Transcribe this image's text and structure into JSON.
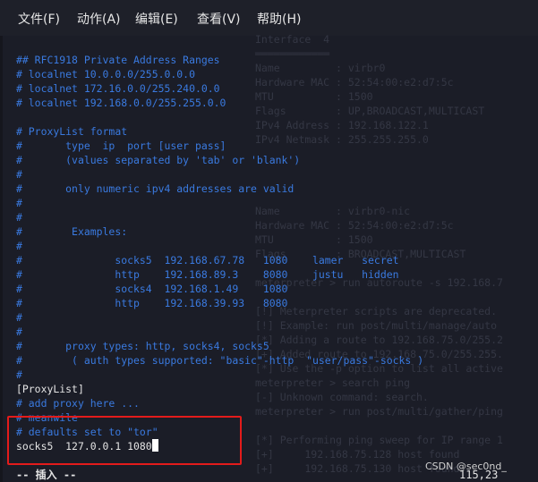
{
  "menu": [
    "文件(F)",
    "动作(A)",
    "编辑(E)",
    "查看(V)",
    "帮助(H)"
  ],
  "background_terminal": [
    "Interface  4",
    "════════════",
    "Name         : virbr0",
    "Hardware MAC : 52:54:00:e2:d7:5c",
    "MTU          : 1500",
    "Flags        : UP,BROADCAST,MULTICAST",
    "IPv4 Address : 192.168.122.1",
    "IPv4 Netmask : 255.255.255.0",
    "",
    "",
    "",
    "",
    "Name         : virbr0-nic",
    "Hardware MAC : 52:54:00:e2:d7:5c",
    "MTU          : 1500",
    "Flags        : BROADCAST,MULTICAST",
    "",
    "meterpreter > run autoroute -s 192.168.7",
    "",
    "[!] Meterpreter scripts are deprecated.",
    "[!] Example: run post/multi/manage/auto",
    "[*] Adding a route to 192.168.75.0/255.2",
    "[+] Added route to 192.168.75.0/255.255.",
    "[*] Use the -p option to list all active",
    "meterpreter > search ping",
    "[-] Unknown command: search.",
    "meterpreter > run post/multi/gather/ping",
    "",
    "[*] Performing ping sweep for IP range 1",
    "[+]     192.168.75.128 host found",
    "[+]     192.168.75.130 host found"
  ],
  "editor_lines": [
    {
      "text": "## RFC1918 Private Address Ranges",
      "type": "comment"
    },
    {
      "text": "# localnet 10.0.0.0/255.0.0.0",
      "type": "comment"
    },
    {
      "text": "# localnet 172.16.0.0/255.240.0.0",
      "type": "comment"
    },
    {
      "text": "# localnet 192.168.0.0/255.255.0.0",
      "type": "comment"
    },
    {
      "text": "",
      "type": "comment"
    },
    {
      "text": "# ProxyList format",
      "type": "comment"
    },
    {
      "text": "#       type  ip  port [user pass]",
      "type": "comment"
    },
    {
      "text": "#       (values separated by 'tab' or 'blank')",
      "type": "comment"
    },
    {
      "text": "#",
      "type": "comment"
    },
    {
      "text": "#       only numeric ipv4 addresses are valid",
      "type": "comment"
    },
    {
      "text": "#",
      "type": "comment"
    },
    {
      "text": "#",
      "type": "comment"
    },
    {
      "text": "#        Examples:",
      "type": "comment"
    },
    {
      "text": "#",
      "type": "comment"
    },
    {
      "text": "#               socks5  192.168.67.78   1080    lamer   secret",
      "type": "comment"
    },
    {
      "text": "#               http    192.168.89.3    8080    justu   hidden",
      "type": "comment"
    },
    {
      "text": "#               socks4  192.168.1.49    1080",
      "type": "comment"
    },
    {
      "text": "#               http    192.168.39.93   8080",
      "type": "comment"
    },
    {
      "text": "#",
      "type": "comment"
    },
    {
      "text": "#",
      "type": "comment"
    },
    {
      "text": "#       proxy types: http, socks4, socks5",
      "type": "comment"
    },
    {
      "text": "#        ( auth types supported: \"basic\"-http  \"user/pass\"-socks )",
      "type": "comment"
    },
    {
      "text": "#",
      "type": "comment"
    },
    {
      "text": "[ProxyList]",
      "type": "plain"
    },
    {
      "text": "# add proxy here ...",
      "type": "comment"
    },
    {
      "text": "# meanwile",
      "type": "comment"
    },
    {
      "text": "# defaults set to \"tor\"",
      "type": "comment"
    },
    {
      "text": "socks5  127.0.0.1 1080",
      "type": "plain"
    }
  ],
  "status": {
    "mode": "-- 插入 --",
    "position": "115,23"
  },
  "watermark": "CSDN @sec0nd_",
  "colors": {
    "background": "#1b1d27",
    "comment": "#3a7ae0",
    "text": "#e4e4e4",
    "highlight_box": "#e31b1b"
  }
}
